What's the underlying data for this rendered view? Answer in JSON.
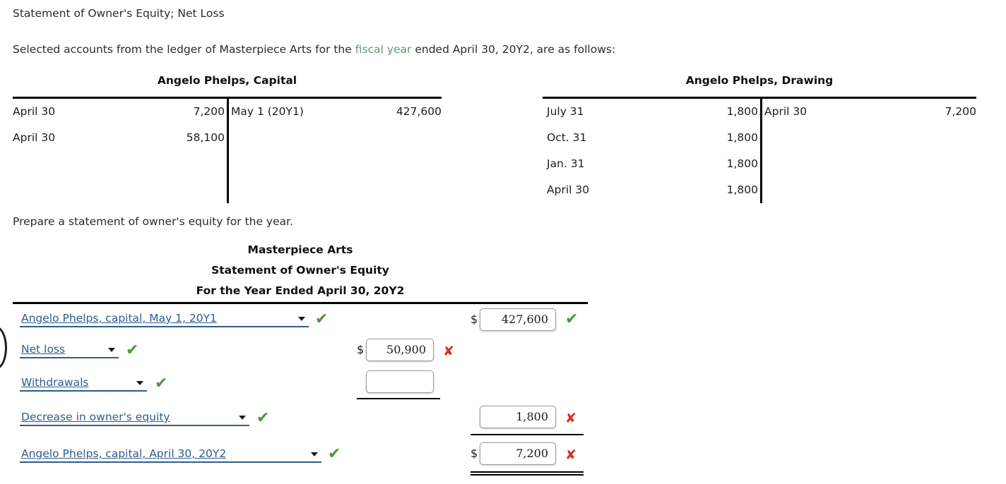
{
  "prompt": {
    "title": "Statement of Owner's Equity; Net Loss",
    "intro_before": "Selected accounts from the ledger of Masterpiece Arts for the ",
    "intro_glossary": "fiscal year",
    "intro_after": " ended April 30, 20Y2, are as follows:",
    "instruction": "Prepare a statement of owner's equity for the year."
  },
  "t_accounts": [
    {
      "title": "Angelo Phelps, Capital",
      "debit_rows": [
        {
          "date": "April 30",
          "amount": "7,200"
        },
        {
          "date": "April 30",
          "amount": "58,100"
        }
      ],
      "credit_rows": [
        {
          "date": "May 1 (20Y1)",
          "amount": "427,600"
        }
      ]
    },
    {
      "title": "Angelo Phelps, Drawing",
      "debit_rows": [
        {
          "date": "July 31",
          "amount": "1,800"
        },
        {
          "date": "Oct. 31",
          "amount": "1,800"
        },
        {
          "date": "Jan. 31",
          "amount": "1,800"
        },
        {
          "date": "April 30",
          "amount": "1,800"
        }
      ],
      "credit_rows": [
        {
          "date": "April 30",
          "amount": "7,200"
        }
      ]
    }
  ],
  "statement": {
    "company": "Masterpiece Arts",
    "title": "Statement of Owner's Equity",
    "period": "For the Year Ended April 30, 20Y2",
    "rows": [
      {
        "label": "Angelo Phelps, capital, May 1, 20Y1",
        "label_status": "correct",
        "col3_dollar": "$",
        "col3_value": "427,600",
        "col3_status": "correct"
      },
      {
        "label": "Net loss",
        "label_status": "correct",
        "col2_dollar": "$",
        "col2_value": "50,900",
        "col2_status": "incorrect"
      },
      {
        "label": "Withdrawals",
        "label_status": "correct",
        "col2_value": "",
        "col2_status": "none"
      },
      {
        "label": "Decrease in owner's equity",
        "label_status": "correct",
        "col3_value": "1,800",
        "col3_status": "incorrect"
      },
      {
        "label": "Angelo Phelps, capital, April 30, 20Y2",
        "label_status": "correct",
        "col3_dollar": "$",
        "col3_value": "7,200",
        "col3_status": "incorrect"
      }
    ]
  },
  "icons": {
    "correct_glyph": "✔",
    "incorrect_glyph": "✘",
    "correct_color": "#4a9638",
    "incorrect_color": "#e02b20"
  }
}
